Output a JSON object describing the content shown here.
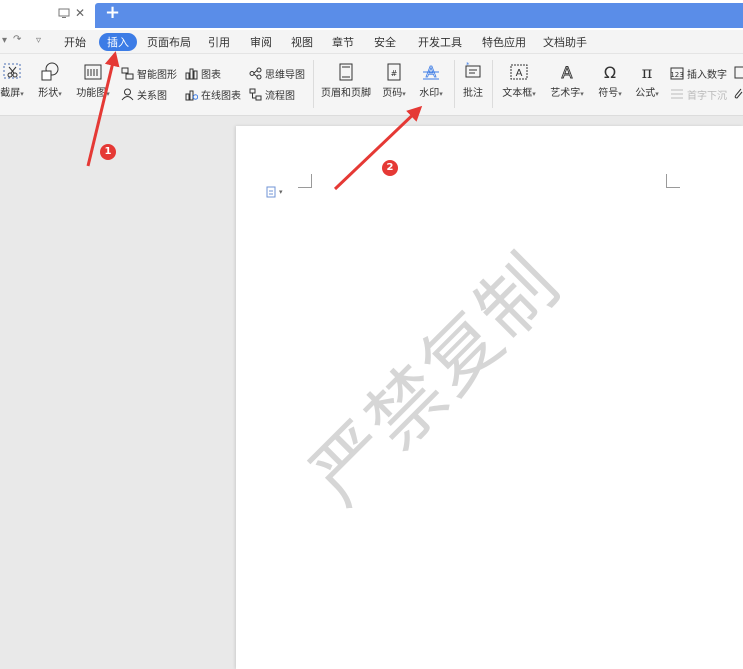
{
  "titlebar": {
    "close_glyph": "✕",
    "add_tab_glyph": "+"
  },
  "menu": {
    "items": [
      "开始",
      "插入",
      "页面布局",
      "引用",
      "审阅",
      "视图",
      "章节",
      "安全",
      "开发工具",
      "特色应用",
      "文档助手"
    ],
    "active": "插入"
  },
  "ribbon": {
    "screenshot": "截屏",
    "shape": "形状",
    "function": "功能图",
    "smart_art": "智能图形",
    "chart": "图表",
    "mind_map": "思维导图",
    "relation": "关系图",
    "online_chart": "在线图表",
    "flowchart": "流程图",
    "header_footer": "页眉和页脚",
    "page_number": "页码",
    "watermark": "水印",
    "comment": "批注",
    "text_box": "文本框",
    "word_art": "艺术字",
    "symbol": "符号",
    "formula": "公式",
    "insert_number": "插入数字",
    "drop_cap": "首字下沉"
  },
  "document": {
    "watermark_text": "严禁复制"
  },
  "annotations": {
    "badge1": "1",
    "badge2": "2",
    "color": "#e53935"
  },
  "colors": {
    "accent": "#3c7ce6",
    "tab": "#5a8de8"
  }
}
